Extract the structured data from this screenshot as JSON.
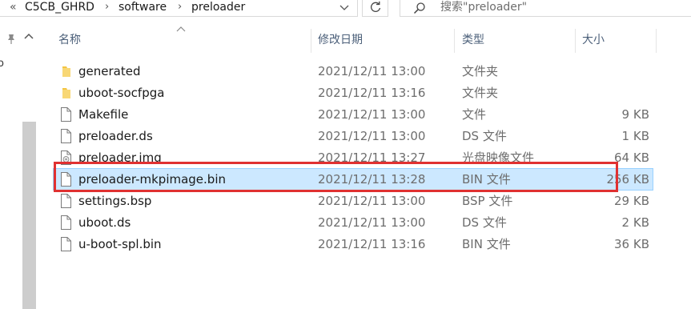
{
  "breadcrumb": {
    "overflow": "«",
    "items": [
      "C5CB_GHRD",
      "software",
      "preloader"
    ],
    "separator": "›"
  },
  "search": {
    "placeholder": "搜索\"preloader\""
  },
  "nav": {
    "cut_text": "o"
  },
  "columns": {
    "name": "名称",
    "date": "修改日期",
    "type": "类型",
    "size": "大小"
  },
  "files": [
    {
      "icon": "folder-icon",
      "name": "generated",
      "date": "2021/12/11 13:00",
      "type": "文件夹",
      "size": ""
    },
    {
      "icon": "folder-icon",
      "name": "uboot-socfpga",
      "date": "2021/12/11 13:16",
      "type": "文件夹",
      "size": ""
    },
    {
      "icon": "file-icon",
      "name": "Makefile",
      "date": "2021/12/11 13:00",
      "type": "文件",
      "size": "9 KB"
    },
    {
      "icon": "file-icon",
      "name": "preloader.ds",
      "date": "2021/12/11 13:00",
      "type": "DS 文件",
      "size": "1 KB"
    },
    {
      "icon": "disc-image-file-icon",
      "name": "preloader.img",
      "date": "2021/12/11 13:27",
      "type": "光盘映像文件",
      "size": "64 KB"
    },
    {
      "icon": "file-icon",
      "name": "preloader-mkpimage.bin",
      "date": "2021/12/11 13:28",
      "type": "BIN 文件",
      "size": "256 KB",
      "selected": true
    },
    {
      "icon": "file-icon",
      "name": "settings.bsp",
      "date": "2021/12/11 13:00",
      "type": "BSP 文件",
      "size": "29 KB"
    },
    {
      "icon": "file-icon",
      "name": "uboot.ds",
      "date": "2021/12/11 13:00",
      "type": "DS 文件",
      "size": "2 KB"
    },
    {
      "icon": "file-icon",
      "name": "u-boot-spl.bin",
      "date": "2021/12/11 13:16",
      "type": "BIN 文件",
      "size": "36 KB"
    }
  ],
  "colors": {
    "selection_bg": "#cce8ff",
    "selection_border": "#99d1ff",
    "annotation_box": "#e03131",
    "folder": "#f4c542"
  }
}
